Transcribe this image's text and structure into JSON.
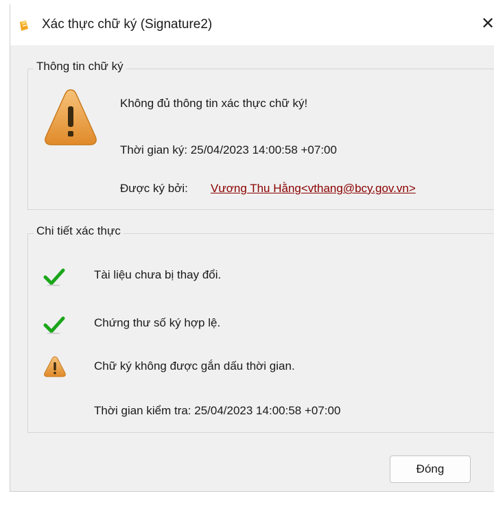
{
  "window": {
    "title": "Xác thực chữ ký (Signature2)",
    "close_glyph": "✕"
  },
  "signature_info": {
    "legend": "Thông tin chữ ký",
    "status": "Không đủ thông tin xác thực chữ ký!",
    "signed_time": "Thời gian ký: 25/04/2023 14:00:58 +07:00",
    "signed_by_label": "Được ký bởi:",
    "signer": "Vương Thu Hằng<vthang@bcy.gov.vn>"
  },
  "verification_details": {
    "legend": "Chi tiết xác thực",
    "items": [
      {
        "icon": "check-icon",
        "text": "Tài liệu chưa bị thay đổi."
      },
      {
        "icon": "check-icon",
        "text": "Chứng thư số ký hợp lệ."
      },
      {
        "icon": "warning-icon",
        "text": "Chữ ký không được gắn dấu thời gian."
      }
    ],
    "check_time": "Thời gian kiểm tra: 25/04/2023 14:00:58 +07:00"
  },
  "buttons": {
    "close_label": "Đóng"
  },
  "colors": {
    "dialog_bg": "#f0f0f0",
    "link": "#8b0000",
    "check_green": "#1aa51a",
    "warning_orange": "#f0a030"
  }
}
